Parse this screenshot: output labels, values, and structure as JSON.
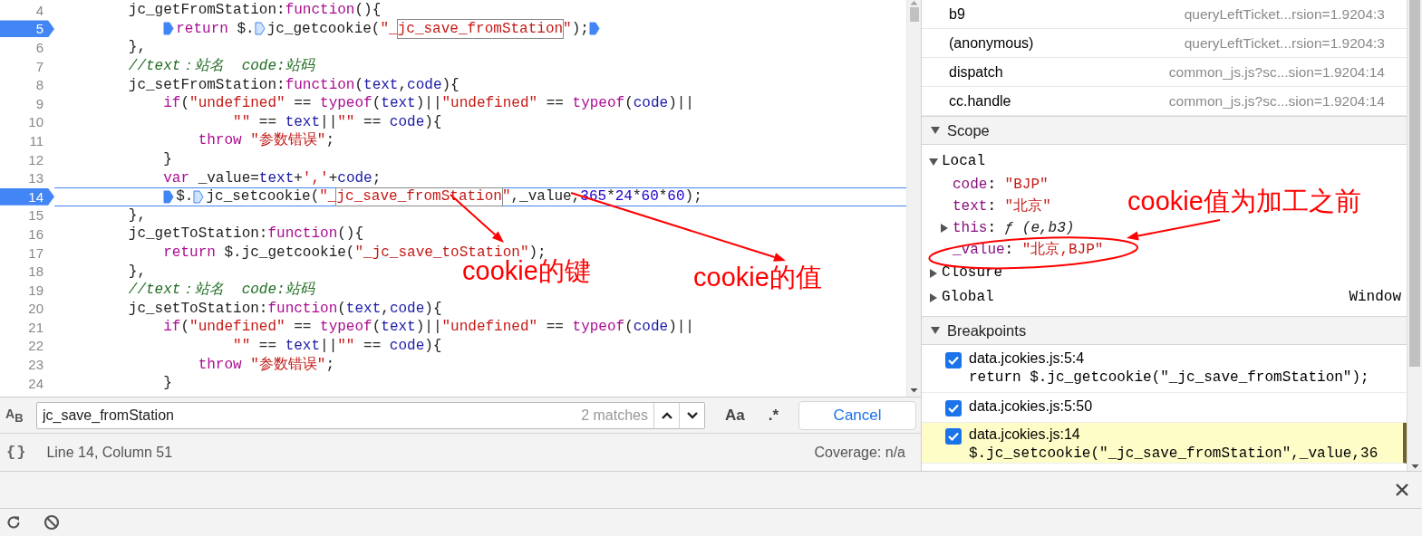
{
  "code": {
    "lines": [
      {
        "number": "4",
        "breakpoint": false,
        "current": false,
        "tokens": [
          {
            "kind": "plain",
            "text": "        jc_getFromStation:"
          },
          {
            "kind": "keyword",
            "text": "function"
          },
          {
            "kind": "plain",
            "text": "(){"
          }
        ]
      },
      {
        "number": "5",
        "breakpoint": true,
        "current": false,
        "tokens": [
          {
            "kind": "marker",
            "active": true
          },
          {
            "kind": "keyword",
            "text": "            return"
          },
          {
            "kind": "plain",
            "text": " $."
          },
          {
            "kind": "marker",
            "active": false
          },
          {
            "kind": "plain",
            "text": "jc_getcookie("
          },
          {
            "kind": "string",
            "text": "\"_"
          },
          {
            "kind": "match",
            "text": "jc_save_fromStation"
          },
          {
            "kind": "string",
            "text": "\""
          },
          {
            "kind": "plain",
            "text": ");"
          },
          {
            "kind": "marker",
            "active": true
          }
        ]
      },
      {
        "number": "6",
        "breakpoint": false,
        "current": false,
        "tokens": [
          {
            "kind": "plain",
            "text": "        },"
          }
        ]
      },
      {
        "number": "7",
        "breakpoint": false,
        "current": false,
        "tokens": [
          {
            "kind": "comment",
            "text": "        //text：站名  code:站码"
          }
        ]
      },
      {
        "number": "8",
        "breakpoint": false,
        "current": false,
        "tokens": [
          {
            "kind": "plain",
            "text": "        jc_setFromStation:"
          },
          {
            "kind": "keyword",
            "text": "function"
          },
          {
            "kind": "plain",
            "text": "("
          },
          {
            "kind": "variable",
            "text": "text"
          },
          {
            "kind": "plain",
            "text": ","
          },
          {
            "kind": "variable",
            "text": "code"
          },
          {
            "kind": "plain",
            "text": "){"
          }
        ]
      },
      {
        "number": "9",
        "breakpoint": false,
        "current": false,
        "tokens": [
          {
            "kind": "keyword",
            "text": "            if"
          },
          {
            "kind": "plain",
            "text": "("
          },
          {
            "kind": "string",
            "text": "\"undefined\""
          },
          {
            "kind": "plain",
            "text": " == "
          },
          {
            "kind": "keyword",
            "text": "typeof"
          },
          {
            "kind": "plain",
            "text": "("
          },
          {
            "kind": "variable",
            "text": "text"
          },
          {
            "kind": "plain",
            "text": ")||"
          },
          {
            "kind": "string",
            "text": "\"undefined\""
          },
          {
            "kind": "plain",
            "text": " == "
          },
          {
            "kind": "keyword",
            "text": "typeof"
          },
          {
            "kind": "plain",
            "text": "("
          },
          {
            "kind": "variable",
            "text": "code"
          },
          {
            "kind": "plain",
            "text": ")||"
          }
        ]
      },
      {
        "number": "10",
        "breakpoint": false,
        "current": false,
        "tokens": [
          {
            "kind": "string",
            "text": "                    \"\""
          },
          {
            "kind": "plain",
            "text": " == "
          },
          {
            "kind": "variable",
            "text": "text"
          },
          {
            "kind": "plain",
            "text": "||"
          },
          {
            "kind": "string",
            "text": "\"\""
          },
          {
            "kind": "plain",
            "text": " == "
          },
          {
            "kind": "variable",
            "text": "code"
          },
          {
            "kind": "plain",
            "text": "){"
          }
        ]
      },
      {
        "number": "11",
        "breakpoint": false,
        "current": false,
        "tokens": [
          {
            "kind": "keyword",
            "text": "                throw"
          },
          {
            "kind": "string",
            "text": " \"参数错误\""
          },
          {
            "kind": "plain",
            "text": ";"
          }
        ]
      },
      {
        "number": "12",
        "breakpoint": false,
        "current": false,
        "tokens": [
          {
            "kind": "plain",
            "text": "            }"
          }
        ]
      },
      {
        "number": "13",
        "breakpoint": false,
        "current": false,
        "tokens": [
          {
            "kind": "keyword",
            "text": "            var"
          },
          {
            "kind": "plain",
            "text": " _value="
          },
          {
            "kind": "variable",
            "text": "text"
          },
          {
            "kind": "plain",
            "text": "+"
          },
          {
            "kind": "string",
            "text": "','"
          },
          {
            "kind": "plain",
            "text": "+"
          },
          {
            "kind": "variable",
            "text": "code"
          },
          {
            "kind": "plain",
            "text": ";"
          }
        ]
      },
      {
        "number": "14",
        "breakpoint": true,
        "current": true,
        "tokens": [
          {
            "kind": "marker",
            "active": true
          },
          {
            "kind": "plain",
            "text": "            $."
          },
          {
            "kind": "marker",
            "active": false
          },
          {
            "kind": "plain",
            "text": "jc_setcookie("
          },
          {
            "kind": "string",
            "text": "\"_"
          },
          {
            "kind": "match",
            "text": "jc_save_fromStation"
          },
          {
            "kind": "string",
            "text": "\""
          },
          {
            "kind": "plain",
            "text": ",_value,"
          },
          {
            "kind": "number",
            "text": "365"
          },
          {
            "kind": "plain",
            "text": "*"
          },
          {
            "kind": "number",
            "text": "24"
          },
          {
            "kind": "plain",
            "text": "*"
          },
          {
            "kind": "number",
            "text": "60"
          },
          {
            "kind": "plain",
            "text": "*"
          },
          {
            "kind": "number",
            "text": "60"
          },
          {
            "kind": "plain",
            "text": ");"
          }
        ]
      },
      {
        "number": "15",
        "breakpoint": false,
        "current": false,
        "tokens": [
          {
            "kind": "plain",
            "text": "        },"
          }
        ]
      },
      {
        "number": "16",
        "breakpoint": false,
        "current": false,
        "tokens": [
          {
            "kind": "plain",
            "text": "        jc_getToStation:"
          },
          {
            "kind": "keyword",
            "text": "function"
          },
          {
            "kind": "plain",
            "text": "(){"
          }
        ]
      },
      {
        "number": "17",
        "breakpoint": false,
        "current": false,
        "tokens": [
          {
            "kind": "keyword",
            "text": "            return"
          },
          {
            "kind": "plain",
            "text": " $.jc_getcookie("
          },
          {
            "kind": "string",
            "text": "\"_jc_save_toStation\""
          },
          {
            "kind": "plain",
            "text": ");"
          }
        ]
      },
      {
        "number": "18",
        "breakpoint": false,
        "current": false,
        "tokens": [
          {
            "kind": "plain",
            "text": "        },"
          }
        ]
      },
      {
        "number": "19",
        "breakpoint": false,
        "current": false,
        "tokens": [
          {
            "kind": "comment",
            "text": "        //text：站名  code:站码"
          }
        ]
      },
      {
        "number": "20",
        "breakpoint": false,
        "current": false,
        "tokens": [
          {
            "kind": "plain",
            "text": "        jc_setToStation:"
          },
          {
            "kind": "keyword",
            "text": "function"
          },
          {
            "kind": "plain",
            "text": "("
          },
          {
            "kind": "variable",
            "text": "text"
          },
          {
            "kind": "plain",
            "text": ","
          },
          {
            "kind": "variable",
            "text": "code"
          },
          {
            "kind": "plain",
            "text": "){"
          }
        ]
      },
      {
        "number": "21",
        "breakpoint": false,
        "current": false,
        "tokens": [
          {
            "kind": "keyword",
            "text": "            if"
          },
          {
            "kind": "plain",
            "text": "("
          },
          {
            "kind": "string",
            "text": "\"undefined\""
          },
          {
            "kind": "plain",
            "text": " == "
          },
          {
            "kind": "keyword",
            "text": "typeof"
          },
          {
            "kind": "plain",
            "text": "("
          },
          {
            "kind": "variable",
            "text": "text"
          },
          {
            "kind": "plain",
            "text": ")||"
          },
          {
            "kind": "string",
            "text": "\"undefined\""
          },
          {
            "kind": "plain",
            "text": " == "
          },
          {
            "kind": "keyword",
            "text": "typeof"
          },
          {
            "kind": "plain",
            "text": "("
          },
          {
            "kind": "variable",
            "text": "code"
          },
          {
            "kind": "plain",
            "text": ")||"
          }
        ]
      },
      {
        "number": "22",
        "breakpoint": false,
        "current": false,
        "tokens": [
          {
            "kind": "string",
            "text": "                    \"\""
          },
          {
            "kind": "plain",
            "text": " == "
          },
          {
            "kind": "variable",
            "text": "text"
          },
          {
            "kind": "plain",
            "text": "||"
          },
          {
            "kind": "string",
            "text": "\"\""
          },
          {
            "kind": "plain",
            "text": " == "
          },
          {
            "kind": "variable",
            "text": "code"
          },
          {
            "kind": "plain",
            "text": "){"
          }
        ]
      },
      {
        "number": "23",
        "breakpoint": false,
        "current": false,
        "tokens": [
          {
            "kind": "keyword",
            "text": "                throw"
          },
          {
            "kind": "string",
            "text": " \"参数错误\""
          },
          {
            "kind": "plain",
            "text": ";"
          }
        ]
      },
      {
        "number": "24",
        "breakpoint": false,
        "current": false,
        "tokens": [
          {
            "kind": "plain",
            "text": "            }"
          }
        ]
      }
    ]
  },
  "find_bar": {
    "toggle": "A$_{B}$",
    "value": "jc_save_fromStation",
    "matches": "2 matches",
    "case_button": "Aa",
    "regex_button": ".*",
    "cancel": "Cancel"
  },
  "status_bar": {
    "format": "{}",
    "position": "Line 14, Column 51",
    "coverage": "Coverage: n/a"
  },
  "call_stack": [
    {
      "name": "b9",
      "location": "queryLeftTicket...rsion=1.9204:3"
    },
    {
      "name": "(anonymous)",
      "location": "queryLeftTicket...rsion=1.9204:3"
    },
    {
      "name": "dispatch",
      "location": "common_js.js?sc...sion=1.9204:14"
    },
    {
      "name": "cc.handle",
      "location": "common_js.js?sc...sion=1.9204:14"
    }
  ],
  "scope": {
    "title": "Scope",
    "expanded": true,
    "sections": [
      {
        "label": "Local",
        "expanded": true,
        "vars": [
          {
            "name": "code",
            "separator": ": ",
            "value": "\"BJP\"",
            "kind": "string"
          },
          {
            "name": "text",
            "separator": ": ",
            "value": "\"北京\"",
            "kind": "string"
          },
          {
            "name": "this",
            "separator": ": ",
            "value": "ƒ (e,b3)",
            "kind": "function",
            "expanded": false
          },
          {
            "name": "_value",
            "separator": ": ",
            "value": "\"北京,BJP\"",
            "kind": "string"
          }
        ]
      },
      {
        "label": "Closure",
        "expanded": false
      },
      {
        "label": "Global",
        "expanded": false,
        "value": "Window"
      }
    ]
  },
  "breakpoints": {
    "title": "Breakpoints",
    "expanded": true,
    "items": [
      {
        "file": "data.jcokies.js:5:4",
        "code": "return $.jc_getcookie(\"_jc_save_fromStation\");",
        "checked": true,
        "selected": false
      },
      {
        "file": "data.jcokies.js:5:50",
        "checked": true,
        "selected": false
      },
      {
        "file": "data.jcokies.js:14",
        "code": "$.jc_setcookie(\"_jc_save_fromStation\",_value,36",
        "checked": true,
        "selected": true
      }
    ]
  },
  "annotations": [
    {
      "text": "cookie的键"
    },
    {
      "text": "cookie的值"
    },
    {
      "text": "cookie值为加工之前"
    }
  ]
}
